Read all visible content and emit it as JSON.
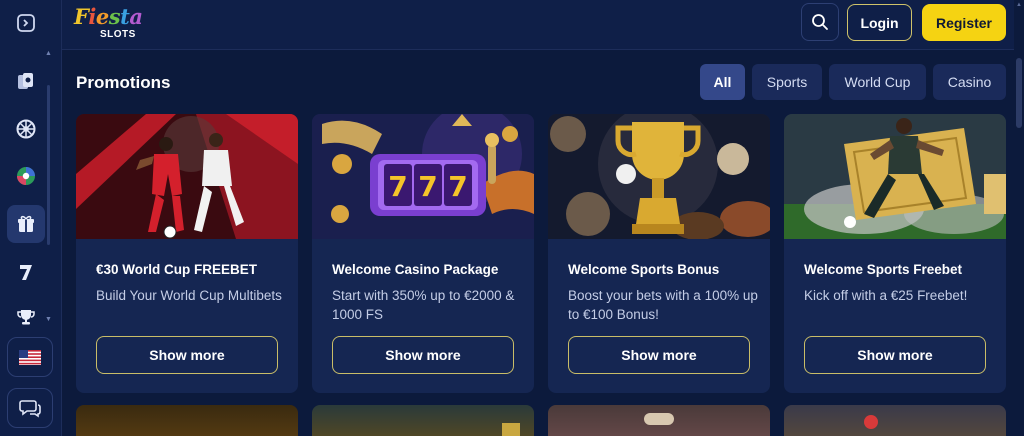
{
  "brand": {
    "logo_line1": "Fiesta",
    "logo_line2": "SLOTS"
  },
  "header": {
    "login_label": "Login",
    "register_label": "Register"
  },
  "sidebar": {
    "items": [
      {
        "icon": "sidebar-toggle-icon"
      },
      {
        "icon": "poker-chips-icon"
      },
      {
        "icon": "roulette-icon"
      },
      {
        "icon": "football-icon"
      },
      {
        "icon": "gift-icon",
        "active": true
      },
      {
        "icon": "lucky-seven-icon"
      },
      {
        "icon": "trophy-icon"
      }
    ],
    "language_flag": "us-flag-icon",
    "chat": "chat-icon"
  },
  "main": {
    "title": "Promotions",
    "filters": [
      {
        "label": "All",
        "active": true
      },
      {
        "label": "Sports"
      },
      {
        "label": "World Cup"
      },
      {
        "label": "Casino"
      }
    ],
    "cards": [
      {
        "title": "€30 World Cup FREEBET",
        "desc": "Build Your World Cup Multibets",
        "button": "Show more"
      },
      {
        "title": "Welcome Casino Package",
        "desc": "Start with 350% up to €2000 & 1000 FS",
        "button": "Show more"
      },
      {
        "title": "Welcome Sports Bonus",
        "desc": "Boost your bets with a 100% up to €100 Bonus!",
        "button": "Show more"
      },
      {
        "title": "Welcome Sports Freebet",
        "desc": "Kick off with a €25 Freebet!",
        "button": "Show more"
      }
    ]
  },
  "colors": {
    "background": "#0c1a3c",
    "card": "#152652",
    "accent_yellow": "#f5d312",
    "filter_active": "#34488a"
  }
}
